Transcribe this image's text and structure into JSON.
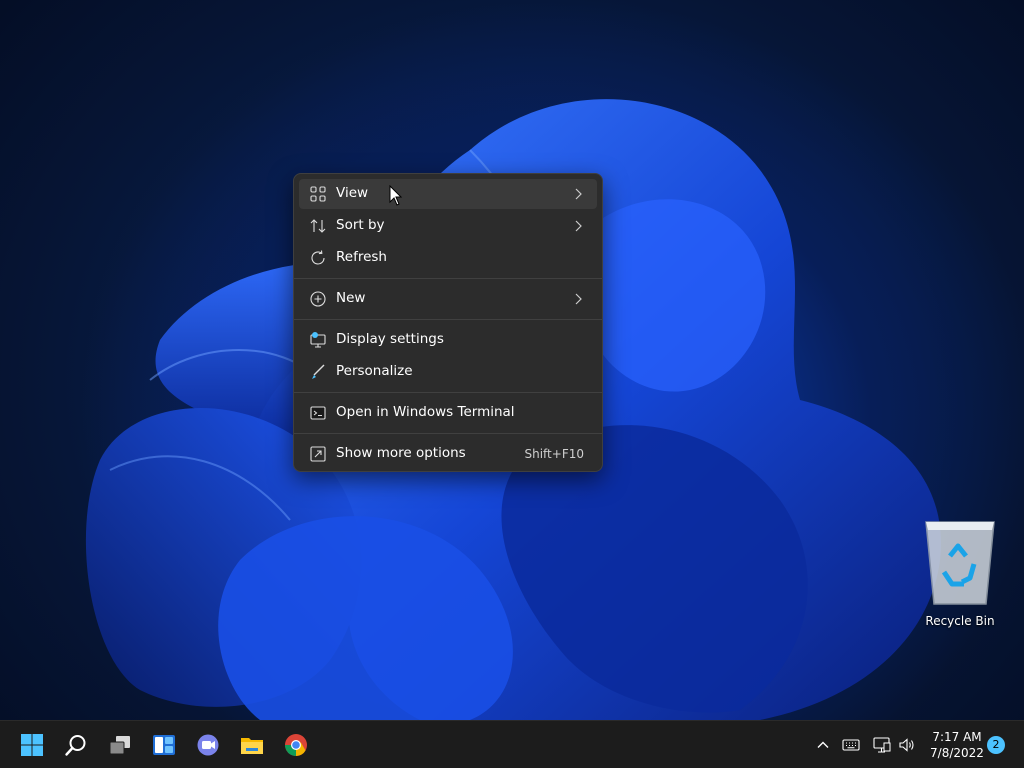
{
  "desktop": {
    "icons": [
      {
        "label": "Recycle Bin",
        "icon": "recycle-bin-icon"
      }
    ]
  },
  "context_menu": {
    "items": [
      {
        "label": "View",
        "icon": "view-grid-icon",
        "has_submenu": true
      },
      {
        "label": "Sort by",
        "icon": "sort-icon",
        "has_submenu": true
      },
      {
        "label": "Refresh",
        "icon": "refresh-icon"
      },
      {
        "label": "New",
        "icon": "new-plus-icon",
        "has_submenu": true
      },
      {
        "label": "Display settings",
        "icon": "display-settings-icon"
      },
      {
        "label": "Personalize",
        "icon": "personalize-brush-icon"
      },
      {
        "label": "Open in Windows Terminal",
        "icon": "terminal-icon"
      },
      {
        "label": "Show more options",
        "icon": "show-more-options-icon",
        "shortcut": "Shift+F10"
      }
    ]
  },
  "taskbar": {
    "apps": [
      {
        "name": "start-button",
        "icon": "windows-logo-icon"
      },
      {
        "name": "search-button",
        "icon": "search-icon"
      },
      {
        "name": "task-view-button",
        "icon": "task-view-icon"
      },
      {
        "name": "widgets-button",
        "icon": "widgets-icon"
      },
      {
        "name": "chat-button",
        "icon": "teams-chat-icon"
      },
      {
        "name": "file-explorer-button",
        "icon": "folder-icon"
      },
      {
        "name": "chrome-button",
        "icon": "chrome-icon"
      }
    ],
    "tray": {
      "icons": [
        "chevron-up-icon",
        "keyboard-icon",
        "network-icon",
        "volume-icon"
      ],
      "time": "7:17 AM",
      "date": "7/8/2022",
      "notification_count": "2"
    }
  },
  "colors": {
    "menu_bg": "#2c2c2c",
    "taskbar_bg": "#1c1c1c",
    "accent": "#4cc2ff",
    "wallpaper_blue": "#0d47c9"
  }
}
